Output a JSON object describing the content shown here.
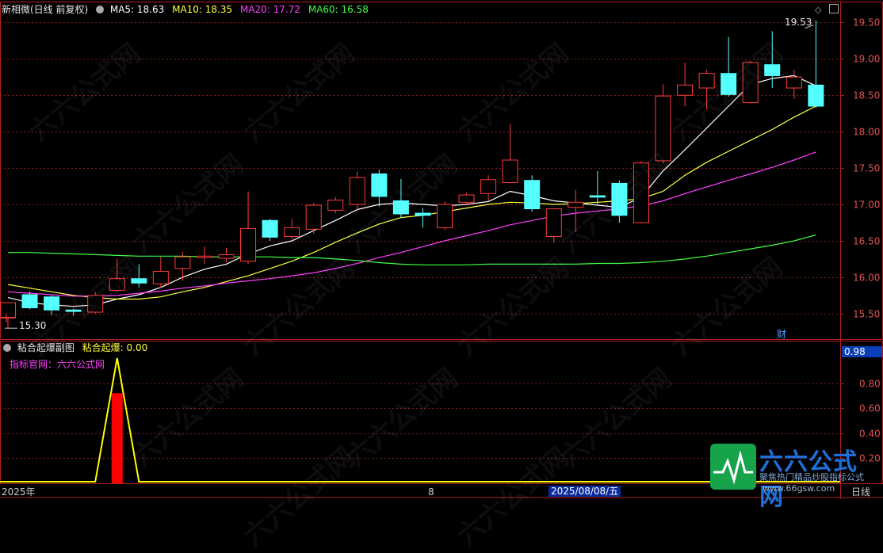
{
  "header": {
    "title": "新相微(日线 前复权)",
    "ma": [
      {
        "label": "MA5: 18.63",
        "color": "#ffffff"
      },
      {
        "label": "MA10: 18.35",
        "color": "#ffff40"
      },
      {
        "label": "MA20: 17.72",
        "color": "#ff40ff"
      },
      {
        "label": "MA60: 16.58",
        "color": "#40ff40"
      }
    ]
  },
  "sub_header": {
    "title": "粘合起爆副图",
    "indicator": "粘合起爆: 0.00",
    "site_label": "指标官网：六六公式网"
  },
  "bottom_axis": {
    "left_label": "2025年",
    "mid_label": "8",
    "date_label": "2025/08/08/五",
    "right_label": "日线"
  },
  "annotations": {
    "high": "19.53",
    "low": "15.30",
    "cai_badge": "财",
    "sub_value_box": "0.98"
  },
  "watermark": "六六公式网",
  "logo": {
    "title": "六六公式网",
    "subtitle": "聚焦热门精品炒股指标公式",
    "url": "www.66gsw.com"
  },
  "colors": {
    "up": "#ff3c3c",
    "down": "#54ffff",
    "grid": "#8b1a1a",
    "axis": "#b02020",
    "ma5": "#ffffff",
    "ma10": "#ffff40",
    "ma20": "#ff40ff",
    "ma60": "#40ff40",
    "sub_line": "#ffff00",
    "sub_bar": "#ff0000"
  },
  "chart_data": [
    {
      "type": "candlestick",
      "title": "新相微(日线 前复权)",
      "ylim": [
        15.15,
        19.7
      ],
      "yticks": [
        15.5,
        16.0,
        16.5,
        17.0,
        17.5,
        18.0,
        18.5,
        19.0,
        19.5
      ],
      "candles": [
        [
          15.45,
          15.65,
          15.3,
          15.44
        ],
        [
          15.76,
          15.58,
          15.8,
          15.56
        ],
        [
          15.73,
          15.55,
          15.75,
          15.48
        ],
        [
          15.55,
          15.53,
          15.57,
          15.47
        ],
        [
          15.52,
          15.75,
          15.8,
          15.5
        ],
        [
          15.82,
          15.98,
          16.25,
          15.8
        ],
        [
          15.98,
          15.92,
          16.18,
          15.86
        ],
        [
          15.91,
          16.08,
          16.28,
          15.85
        ],
        [
          16.12,
          16.28,
          16.35,
          15.95
        ],
        [
          16.27,
          16.29,
          16.42,
          16.18
        ],
        [
          16.26,
          16.31,
          16.4,
          16.2
        ],
        [
          16.22,
          16.67,
          17.18,
          16.18
        ],
        [
          16.78,
          16.55,
          16.8,
          16.5
        ],
        [
          16.56,
          16.68,
          16.8,
          16.52
        ],
        [
          16.66,
          16.99,
          17.02,
          16.6
        ],
        [
          16.92,
          17.06,
          17.1,
          16.88
        ],
        [
          17.0,
          17.37,
          17.45,
          16.9
        ],
        [
          17.42,
          17.11,
          17.48,
          16.97
        ],
        [
          17.05,
          16.87,
          17.35,
          16.82
        ],
        [
          16.88,
          16.85,
          16.95,
          16.68
        ],
        [
          16.68,
          17.0,
          17.04,
          16.65
        ],
        [
          17.03,
          17.13,
          17.16,
          17.0
        ],
        [
          17.15,
          17.34,
          17.4,
          17.05
        ],
        [
          17.3,
          17.61,
          18.1,
          17.3
        ],
        [
          17.33,
          16.94,
          17.4,
          16.9
        ],
        [
          16.56,
          16.94,
          16.94,
          16.47
        ],
        [
          16.96,
          17.03,
          17.2,
          16.62
        ],
        [
          17.12,
          17.1,
          17.46,
          17.0
        ],
        [
          17.29,
          16.85,
          17.33,
          16.75
        ],
        [
          16.75,
          17.57,
          17.6,
          16.74
        ],
        [
          17.6,
          18.49,
          18.65,
          17.56
        ],
        [
          18.5,
          18.64,
          18.95,
          18.35
        ],
        [
          18.6,
          18.8,
          18.85,
          18.3
        ],
        [
          18.8,
          18.51,
          19.3,
          18.48
        ],
        [
          18.4,
          18.95,
          18.97,
          18.38
        ],
        [
          18.92,
          18.77,
          19.38,
          18.6
        ],
        [
          18.6,
          18.75,
          18.85,
          18.45
        ],
        [
          18.64,
          18.35,
          19.53,
          18.33
        ]
      ],
      "series": [
        {
          "name": "MA5",
          "values": [
            15.72,
            15.65,
            15.62,
            15.6,
            15.62,
            15.7,
            15.76,
            15.86,
            16.0,
            16.11,
            16.18,
            16.32,
            16.43,
            16.5,
            16.64,
            16.78,
            16.93,
            17.0,
            17.02,
            17.0,
            16.98,
            17.0,
            17.04,
            17.18,
            17.12,
            17.05,
            17.02,
            16.99,
            16.96,
            17.1,
            17.46,
            17.75,
            18.05,
            18.35,
            18.65,
            18.73,
            18.77,
            18.63
          ]
        },
        {
          "name": "MA10",
          "values": [
            15.9,
            15.85,
            15.8,
            15.75,
            15.72,
            15.7,
            15.7,
            15.73,
            15.8,
            15.86,
            15.94,
            16.02,
            16.12,
            16.22,
            16.34,
            16.48,
            16.61,
            16.73,
            16.82,
            16.85,
            16.9,
            16.95,
            17.0,
            17.03,
            17.02,
            17.0,
            17.01,
            17.03,
            17.05,
            17.08,
            17.18,
            17.4,
            17.58,
            17.73,
            17.88,
            18.03,
            18.2,
            18.35
          ]
        },
        {
          "name": "MA20",
          "values": [
            15.8,
            15.78,
            15.76,
            15.74,
            15.74,
            15.75,
            15.78,
            15.81,
            15.85,
            15.88,
            15.92,
            15.95,
            15.98,
            16.02,
            16.06,
            16.12,
            16.19,
            16.27,
            16.34,
            16.42,
            16.5,
            16.57,
            16.64,
            16.72,
            16.78,
            16.84,
            16.88,
            16.91,
            16.94,
            16.98,
            17.05,
            17.15,
            17.24,
            17.33,
            17.42,
            17.51,
            17.61,
            17.72
          ]
        },
        {
          "name": "MA60",
          "values": [
            16.34,
            16.34,
            16.33,
            16.32,
            16.31,
            16.3,
            16.29,
            16.29,
            16.29,
            16.28,
            16.28,
            16.28,
            16.28,
            16.27,
            16.27,
            16.25,
            16.23,
            16.2,
            16.18,
            16.17,
            16.17,
            16.17,
            16.18,
            16.18,
            16.18,
            16.18,
            16.18,
            16.19,
            16.19,
            16.2,
            16.22,
            16.25,
            16.29,
            16.34,
            16.39,
            16.44,
            16.5,
            16.58
          ]
        }
      ]
    },
    {
      "type": "line",
      "title": "粘合起爆副图",
      "ylim": [
        0,
        1.0
      ],
      "yticks": [
        0.2,
        0.4,
        0.6,
        0.8
      ],
      "series": [
        {
          "name": "粘合起爆",
          "values": [
            0,
            0,
            0,
            0,
            0,
            1.0,
            0,
            0,
            0,
            0,
            0,
            0,
            0,
            0,
            0,
            0,
            0,
            0,
            0,
            0,
            0,
            0,
            0,
            0,
            0,
            0,
            0,
            0,
            0,
            0,
            0,
            0,
            0,
            0,
            0,
            0,
            0,
            0
          ]
        }
      ],
      "bars": [
        0,
        0,
        0,
        0,
        0,
        0.72,
        0,
        0,
        0,
        0,
        0,
        0,
        0,
        0,
        0,
        0,
        0,
        0,
        0,
        0,
        0,
        0,
        0,
        0,
        0,
        0,
        0,
        0,
        0,
        0,
        0,
        0,
        0,
        0,
        0,
        0,
        0,
        0
      ]
    }
  ]
}
